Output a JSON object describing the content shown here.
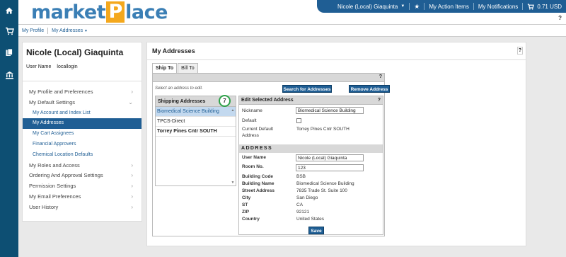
{
  "rail": {
    "icons": [
      "home-icon",
      "cart-icon",
      "documents-icon",
      "bank-icon"
    ]
  },
  "header": {
    "logo": {
      "pre": "market",
      "p": "P",
      "post": "lace"
    },
    "user_menu": "Nicole (Local) Giaquinta",
    "action_items": "My Action Items",
    "notifications": "My Notifications",
    "cart_amount": "0.71 USD",
    "help": "?"
  },
  "subnav": {
    "profile": "My Profile",
    "addresses": "My Addresses"
  },
  "sidebar": {
    "name": "Nicole (Local) Giaquinta",
    "username_label": "User Name",
    "username_value": "locallogin",
    "items": [
      {
        "label": "My Profile and Preferences",
        "type": "top",
        "chevron": "›"
      },
      {
        "label": "My Default Settings",
        "type": "top",
        "chevron": "⌄"
      },
      {
        "label": "My Account and Index List",
        "type": "sub"
      },
      {
        "label": "My Addresses",
        "type": "sub",
        "active": true
      },
      {
        "label": "My Cart Assignees",
        "type": "sub"
      },
      {
        "label": "Financial Approvers",
        "type": "sub"
      },
      {
        "label": "Chemical Location Defaults",
        "type": "sub"
      },
      {
        "label": "My Roles and Access",
        "type": "top",
        "chevron": "›"
      },
      {
        "label": "Ordering And Approval Settings",
        "type": "top",
        "chevron": "›"
      },
      {
        "label": "Permission Settings",
        "type": "top",
        "chevron": "›"
      },
      {
        "label": "My Email Preferences",
        "type": "top",
        "chevron": "›"
      },
      {
        "label": "User History",
        "type": "top",
        "chevron": "›"
      }
    ]
  },
  "main": {
    "title": "My Addresses",
    "help": "?",
    "tabs": [
      "Ship To",
      "Bill To"
    ],
    "tab_help": "?",
    "hint": "Select an address to edit.",
    "search_button": "Search for Addresses",
    "remove_button": "Remove Address",
    "shipping": {
      "title": "Shipping Addresses",
      "count_badge": "7",
      "items": [
        {
          "label": "Biomedical Science Building",
          "selected": true
        },
        {
          "label": "TPCS-Direct"
        },
        {
          "label": "Torrey Pines Cntr SOUTH",
          "bold": true
        }
      ]
    },
    "edit": {
      "title": "Edit Selected Address",
      "help": "?",
      "nickname_label": "Nickname",
      "nickname_value": "Biomedical Science Building",
      "default_label": "Default",
      "current_default_label_1": "Current Default",
      "current_default_label_2": "Address",
      "current_default_value": "Torrey Pines Cntr SOUTH",
      "address_header": "ADDRESS",
      "username_label": "User Name",
      "username_value": "Nicole (Local) Giaquinta",
      "room_label": "Room No.",
      "room_value": "123",
      "building_code_label": "Building Code",
      "building_code_value": "BSB",
      "building_name_label": "Building Name",
      "building_name_value": "Biomedical Science Building",
      "street_label": "Street Address",
      "street_value": "7835 Trade St. Suite 100",
      "city_label": "City",
      "city_value": "San Diego",
      "st_label": "ST",
      "st_value": "CA",
      "zip_label": "ZIP",
      "zip_value": "92121",
      "country_label": "Country",
      "country_value": "United States",
      "save_button": "Save"
    }
  }
}
